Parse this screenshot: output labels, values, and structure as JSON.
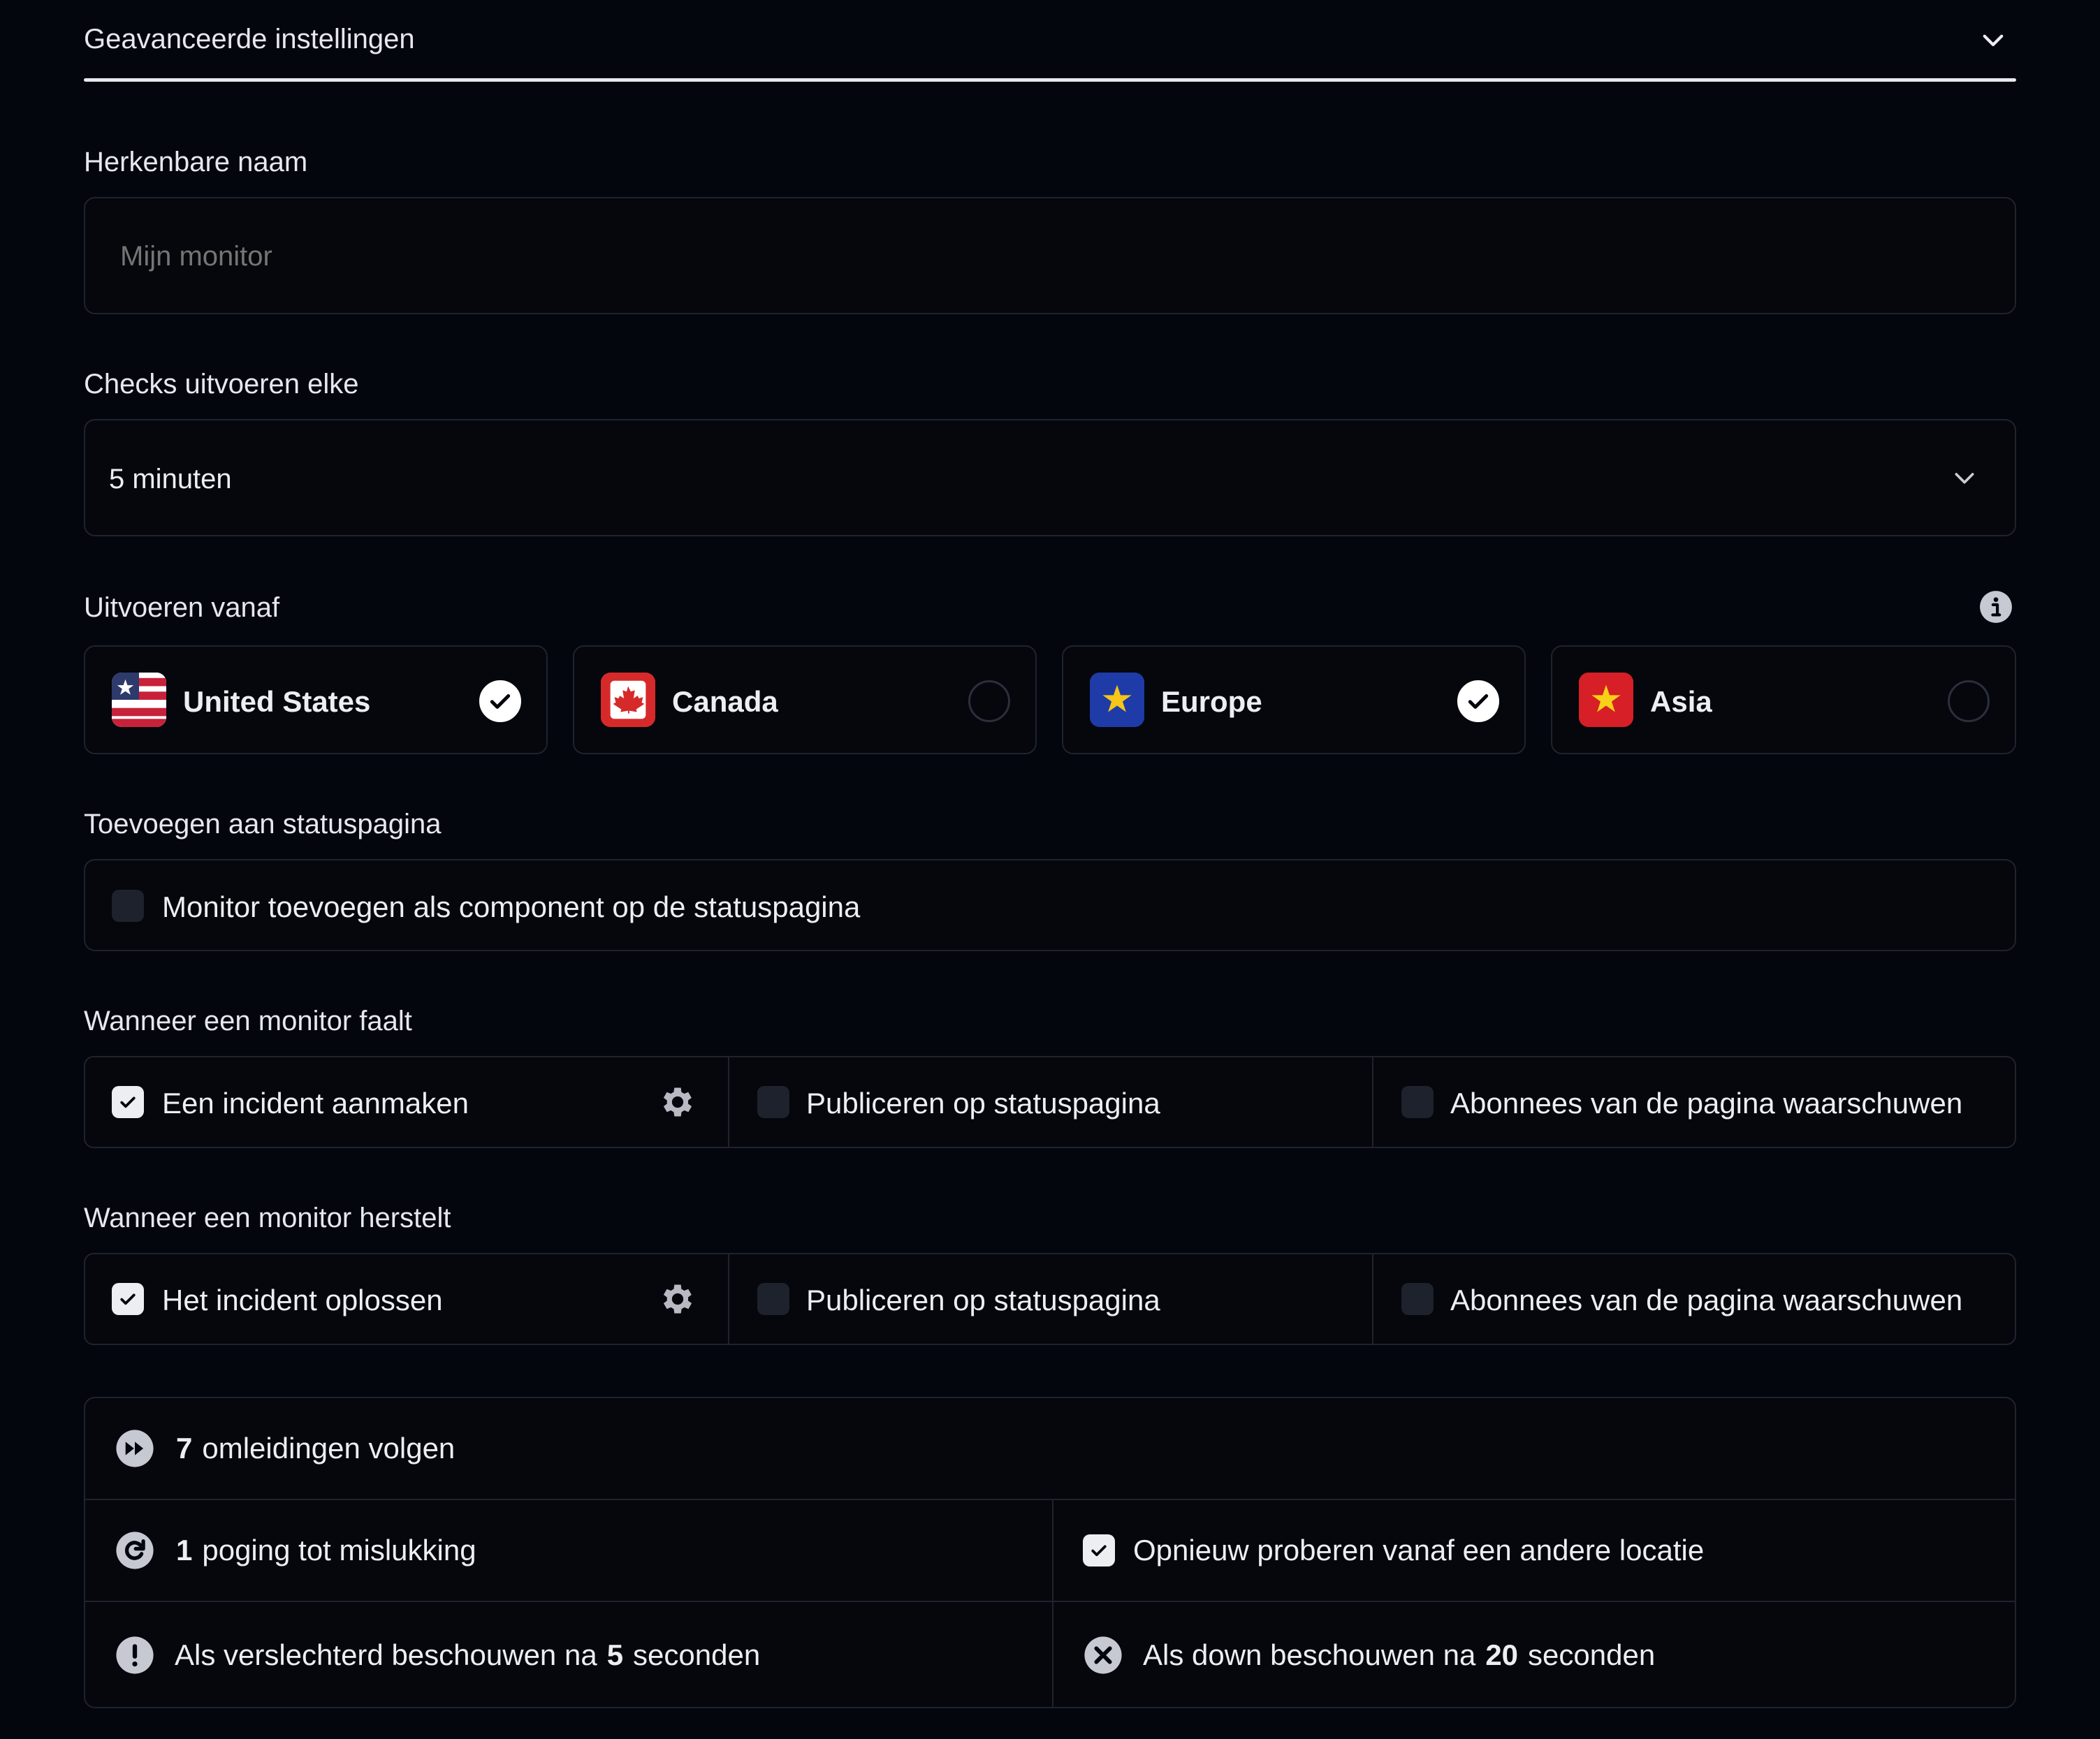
{
  "header": {
    "title": "Geavanceerde instellingen",
    "icon": "chevron-down-icon"
  },
  "name_field": {
    "label": "Herkenbare naam",
    "placeholder": "Mijn monitor",
    "value": ""
  },
  "interval": {
    "label": "Checks uitvoeren elke",
    "selected": "5 minuten"
  },
  "regions": {
    "label": "Uitvoeren vanaf",
    "info_icon": "info-icon",
    "items": [
      {
        "name": "United States",
        "selected": true,
        "flag": "us-flag-icon"
      },
      {
        "name": "Canada",
        "selected": false,
        "flag": "canada-flag-icon"
      },
      {
        "name": "Europe",
        "selected": true,
        "flag": "eu-flag-icon"
      },
      {
        "name": "Asia",
        "selected": false,
        "flag": "asia-flag-icon"
      }
    ]
  },
  "status_page": {
    "label": "Toevoegen aan statuspagina",
    "option": {
      "label": "Monitor toevoegen als component op de statuspagina",
      "checked": false
    }
  },
  "on_fail": {
    "label": "Wanneer een monitor faalt",
    "options": [
      {
        "label": "Een incident aanmaken",
        "checked": true,
        "has_settings": true
      },
      {
        "label": "Publiceren op statuspagina",
        "checked": false
      },
      {
        "label": "Abonnees van de pagina waarschuwen",
        "checked": false
      }
    ]
  },
  "on_recover": {
    "label": "Wanneer een monitor herstelt",
    "options": [
      {
        "label": "Het incident oplossen",
        "checked": true,
        "has_settings": true
      },
      {
        "label": "Publiceren op statuspagina",
        "checked": false
      },
      {
        "label": "Abonnees van de pagina waarschuwen",
        "checked": false
      }
    ]
  },
  "advanced": {
    "redirects": {
      "count": "7",
      "text": "omleidingen volgen"
    },
    "retries": {
      "count": "1",
      "text": "poging tot mislukking"
    },
    "retry_location": {
      "label": "Opnieuw proberen vanaf een andere locatie",
      "checked": true
    },
    "degraded": {
      "prefix": "Als verslechterd beschouwen na",
      "value": "5",
      "suffix": "seconden"
    },
    "down": {
      "prefix": "Als down beschouwen na",
      "value": "20",
      "suffix": "seconden"
    }
  },
  "colors": {
    "background": "#04060d",
    "border": "#1f232e",
    "text": "#eceef2",
    "muted": "#6f7585"
  }
}
